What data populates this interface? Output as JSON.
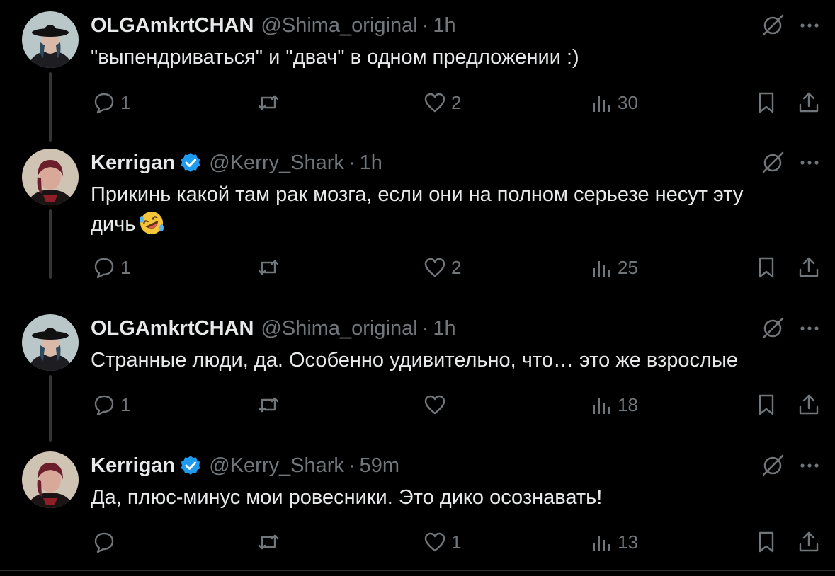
{
  "tweets": [
    {
      "name": "OLGAmkrtCHAN",
      "handle": "@Shima_original",
      "separator": "·",
      "time": "1h",
      "verified": false,
      "text": "\"выпендриваться\" и \"двач\" в одном предложении :)",
      "replies": "1",
      "retweets": "",
      "likes": "2",
      "views": "30"
    },
    {
      "name": "Kerrigan",
      "handle": "@Kerry_Shark",
      "separator": "·",
      "time": "1h",
      "verified": true,
      "text": "Прикинь какой там рак мозга, если они на полном серьезе несут эту дичь",
      "emoji": "rolling-on-floor-laughing",
      "replies": "1",
      "retweets": "",
      "likes": "2",
      "views": "25"
    },
    {
      "name": "OLGAmkrtCHAN",
      "handle": "@Shima_original",
      "separator": "·",
      "time": "1h",
      "verified": false,
      "text": "Странные люди, да. Особенно удивительно, что… это же взрослые",
      "replies": "1",
      "retweets": "",
      "likes": "",
      "views": "18"
    },
    {
      "name": "Kerrigan",
      "handle": "@Kerry_Shark",
      "separator": "·",
      "time": "59m",
      "verified": true,
      "text": "Да, плюс-минус мои ровесники. Это дико осознавать!",
      "replies": "",
      "retweets": "",
      "likes": "1",
      "views": "13"
    }
  ],
  "icons": {
    "reply": "reply-icon",
    "retweet": "retweet-icon",
    "like": "heart-icon",
    "views": "views-icon",
    "bookmark": "bookmark-icon",
    "share": "share-icon",
    "grok": "grok-icon",
    "more": "more-icon",
    "verified": "verified-badge-icon"
  },
  "colors": {
    "background": "#000000",
    "text": "#e7e9ea",
    "muted": "#71767b",
    "verified": "#1d9bf0"
  }
}
